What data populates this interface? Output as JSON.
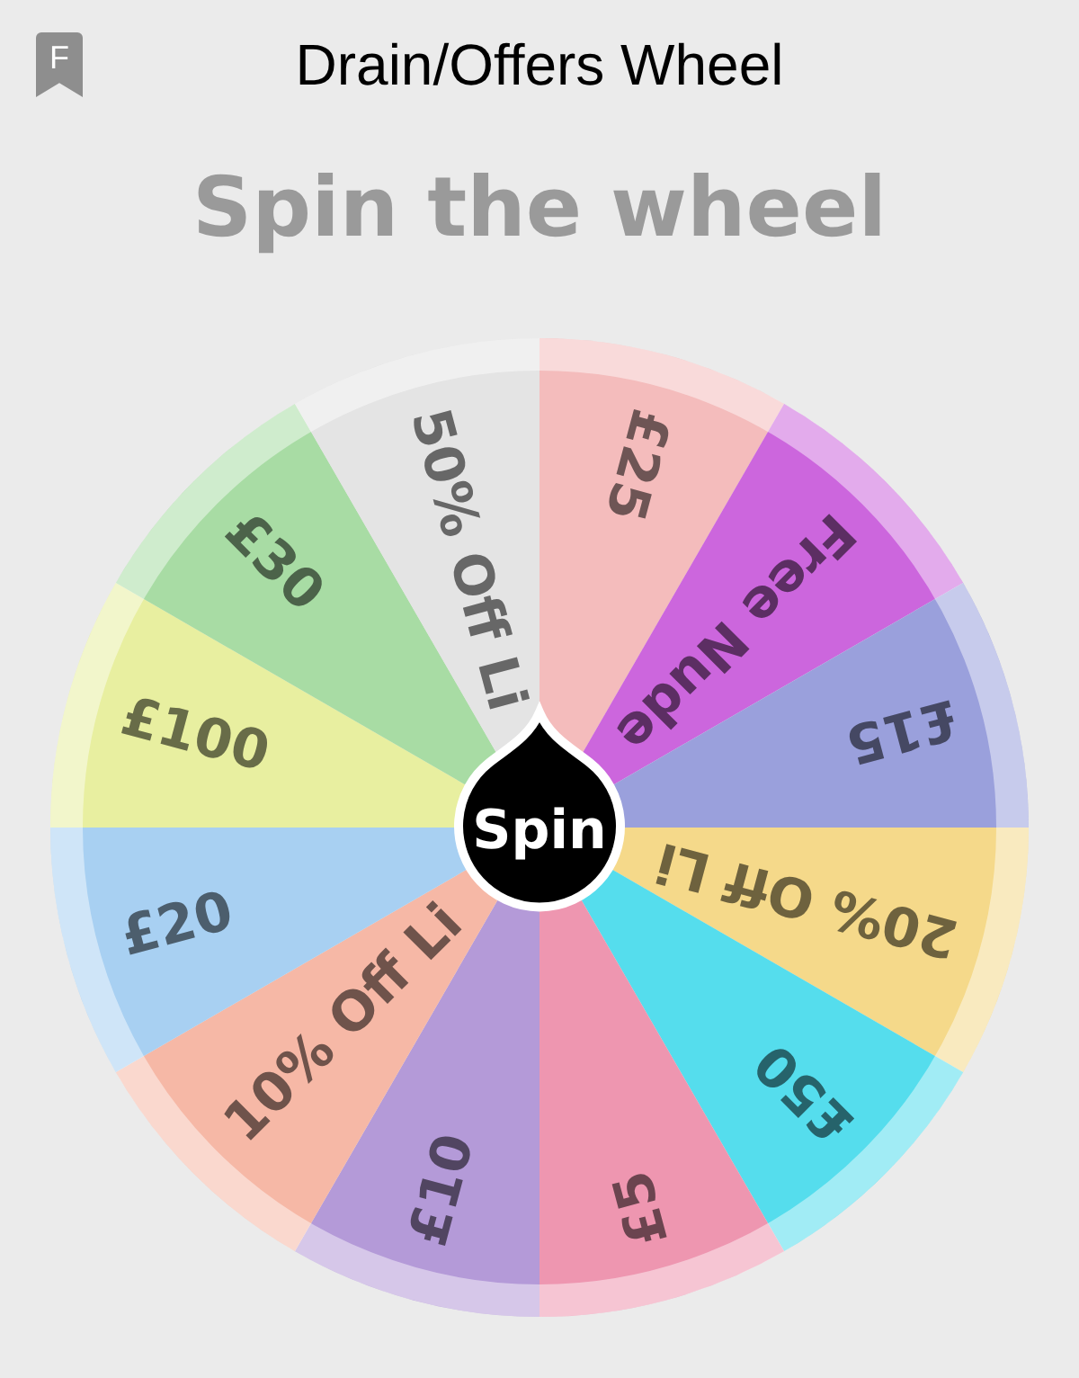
{
  "header": {
    "title": "Drain/Offers Wheel",
    "badge": "F"
  },
  "heading": "Spin the wheel",
  "wheel": {
    "segments": [
      {
        "label": "£25",
        "color": "#f4bcbc"
      },
      {
        "label": "Free Nude",
        "color": "#cc66dd"
      },
      {
        "label": "£15",
        "color": "#9aa0dc"
      },
      {
        "label": "20% Off Li",
        "color": "#f5d98a"
      },
      {
        "label": "£50",
        "color": "#55dded"
      },
      {
        "label": "£5",
        "color": "#ee96b0"
      },
      {
        "label": "£10",
        "color": "#b49ad8"
      },
      {
        "label": "10% Off Li",
        "color": "#f6b8a6"
      },
      {
        "label": "£20",
        "color": "#a8d0f2"
      },
      {
        "label": "£100",
        "color": "#e8efa0"
      },
      {
        "label": "£30",
        "color": "#a8dca4"
      },
      {
        "label": "50% Off Li",
        "color": "#e4e4e4"
      }
    ],
    "spin_button": "Spin"
  }
}
